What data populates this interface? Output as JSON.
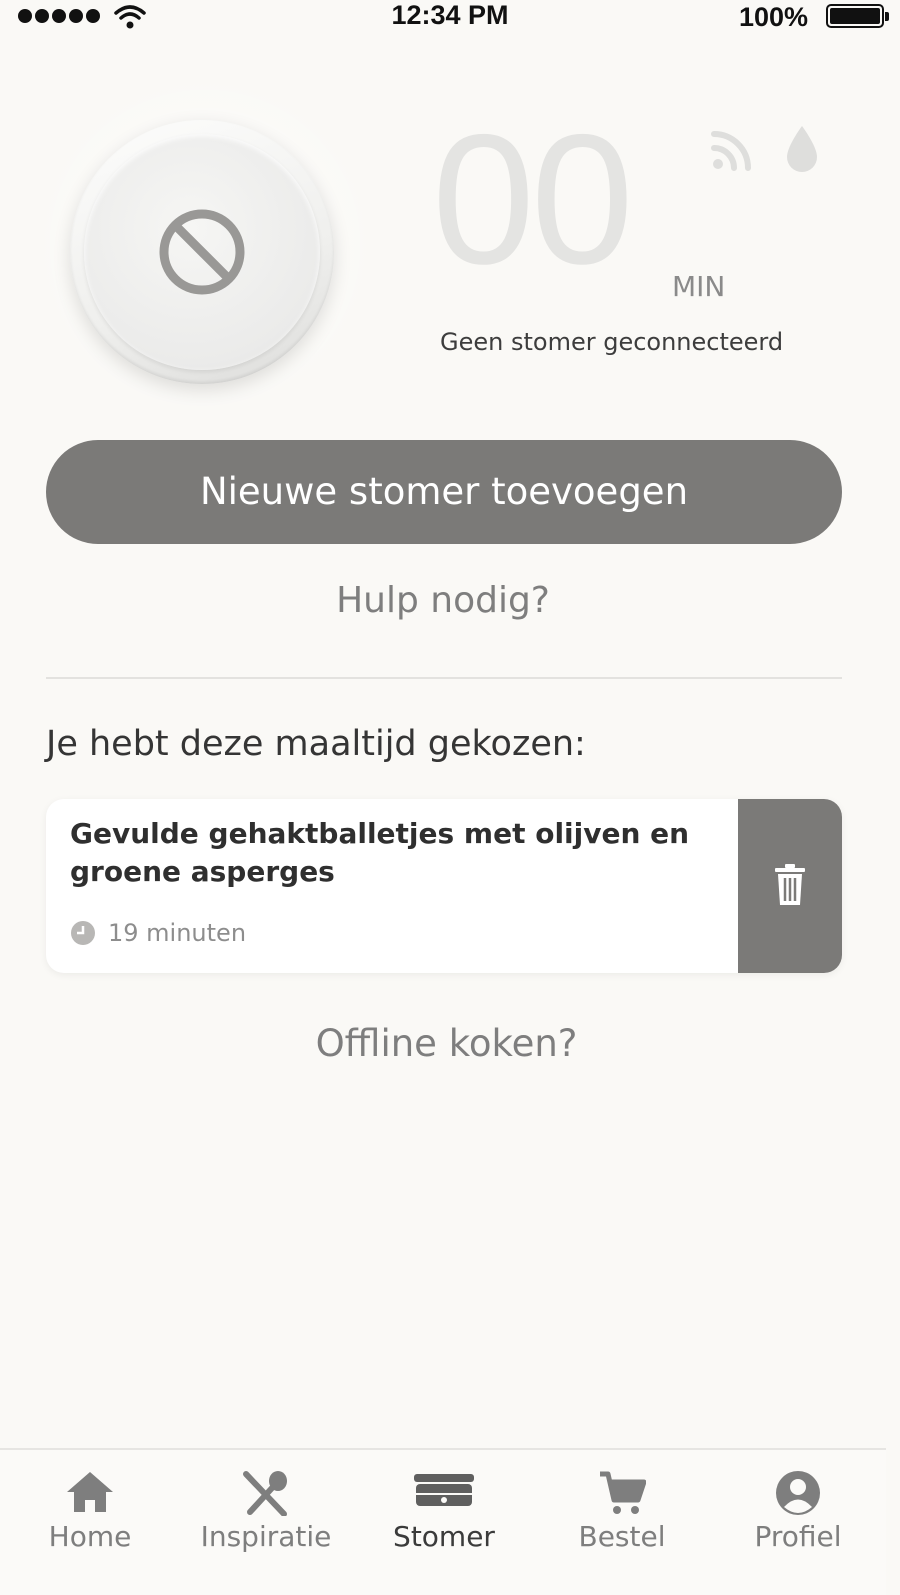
{
  "status_bar": {
    "time": "12:34 PM",
    "battery": "100%"
  },
  "timer": {
    "value": "00",
    "unit": "MIN",
    "status": "Geen stomer geconnecteerd"
  },
  "actions": {
    "add_steamer": "Nieuwe stomer toevoegen",
    "help": "Hulp nodig?",
    "offline": "Offline koken?"
  },
  "meal_section": {
    "title": "Je hebt deze maaltijd gekozen:",
    "meal": {
      "name": "Gevulde gehaktballetjes met olijven en groene asperges",
      "duration": "19 minuten"
    }
  },
  "tabs": [
    {
      "label": "Home",
      "icon": "home-icon",
      "active": false
    },
    {
      "label": "Inspiratie",
      "icon": "utensils-icon",
      "active": false
    },
    {
      "label": "Stomer",
      "icon": "steamer-icon",
      "active": true
    },
    {
      "label": "Bestel",
      "icon": "cart-icon",
      "active": false
    },
    {
      "label": "Profiel",
      "icon": "profile-icon",
      "active": false
    }
  ],
  "colors": {
    "accent": "#7b7a78",
    "background": "#faf9f6",
    "text": "#3a3a3a",
    "muted": "#7e7e7e"
  }
}
